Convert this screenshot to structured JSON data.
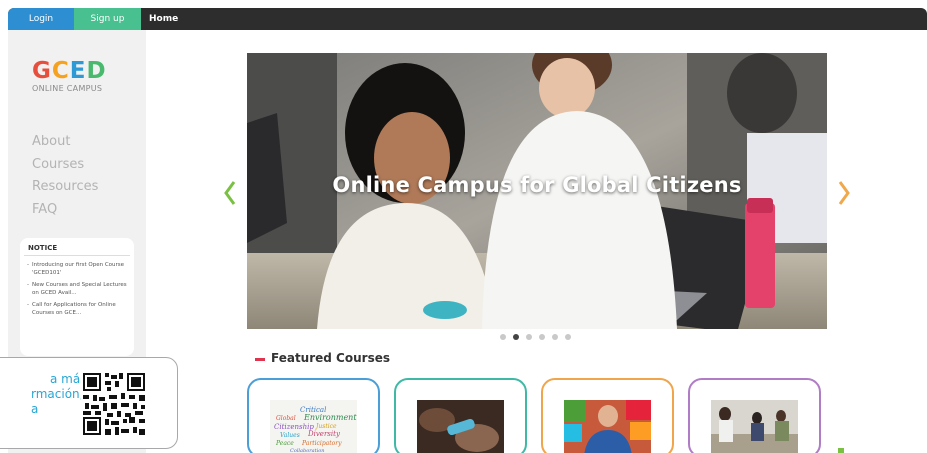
{
  "topbar": {
    "login": "Login",
    "signup": "Sign up",
    "home": "Home"
  },
  "logo": {
    "letters": [
      {
        "char": "G",
        "color": "#e84e3c"
      },
      {
        "char": "C",
        "color": "#f6a21e"
      },
      {
        "char": "E",
        "color": "#2d9ad6"
      },
      {
        "char": "D",
        "color": "#49b96e"
      }
    ],
    "subtitle": "ONLINE CAMPUS"
  },
  "nav": [
    "About",
    "Courses",
    "Resources",
    "FAQ"
  ],
  "notice": {
    "title": "NOTICE",
    "items": [
      "Introducing our first Open Course 'GCED101'",
      "New Courses and Special Lectures on GCED Avail...",
      "Call for Applications for Online Courses on GCE..."
    ]
  },
  "qr_overlay": {
    "lines": [
      "a más",
      "rmación,",
      "a"
    ]
  },
  "hero": {
    "title": "Online Campus for Global Citizens",
    "slide_count": 6,
    "active_slide": 2
  },
  "featured": {
    "title": "Featured Courses",
    "cards": [
      {
        "border": "#4a9fd8",
        "image": "word-cloud"
      },
      {
        "border": "#3fb9a6",
        "image": "hands-photo"
      },
      {
        "border": "#f0a54a",
        "image": "presenter-photo"
      },
      {
        "border": "#b07cc6",
        "image": "classroom-photo"
      }
    ]
  },
  "colors": {
    "login_bg": "#2d8ed2",
    "signup_bg": "#49c08f",
    "arrow": "#7ac143",
    "accent_bar": "#e0334e"
  }
}
